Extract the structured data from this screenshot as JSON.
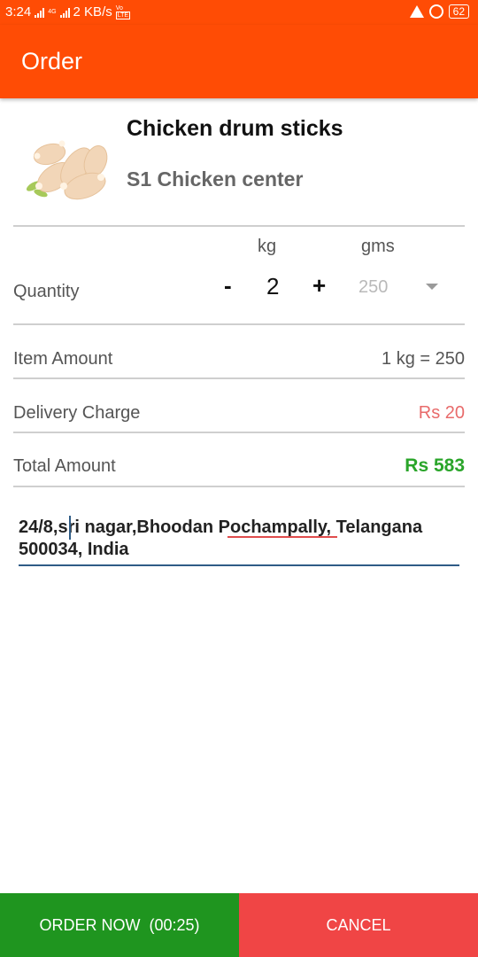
{
  "status_bar": {
    "time": "3:24",
    "net_label": "4G",
    "speed": "2 KB/s",
    "volte_top": "Vo",
    "volte_bottom": "LTE",
    "battery": "62"
  },
  "app_bar": {
    "title": "Order"
  },
  "product": {
    "name": "Chicken drum sticks",
    "shop": "S1 Chicken center",
    "image_icon": "chicken-drumsticks-image"
  },
  "quantity": {
    "label": "Quantity",
    "kg_label": "kg",
    "gms_label": "gms",
    "minus": "-",
    "kg_value": "2",
    "plus": "+",
    "gms_selected": "250"
  },
  "item_amount": {
    "label": "Item Amount",
    "value": "1 kg = 250"
  },
  "delivery": {
    "label": "Delivery Charge",
    "value": "Rs 20"
  },
  "total": {
    "label": "Total Amount",
    "value": "Rs 583"
  },
  "address": {
    "part1": " 24/8,",
    "part2": "sri nagar,Bhoodan ",
    "part3": "Pochampally",
    "part4": ", Telangana 500034, India"
  },
  "buttons": {
    "order_now": "ORDER NOW  (00:25)",
    "cancel": "CANCEL"
  },
  "colors": {
    "primary": "#ff4c05",
    "order_green": "#1f951f",
    "cancel_red": "#f04545",
    "delivery_red": "#e86b6b",
    "total_green": "#2aa52a"
  }
}
